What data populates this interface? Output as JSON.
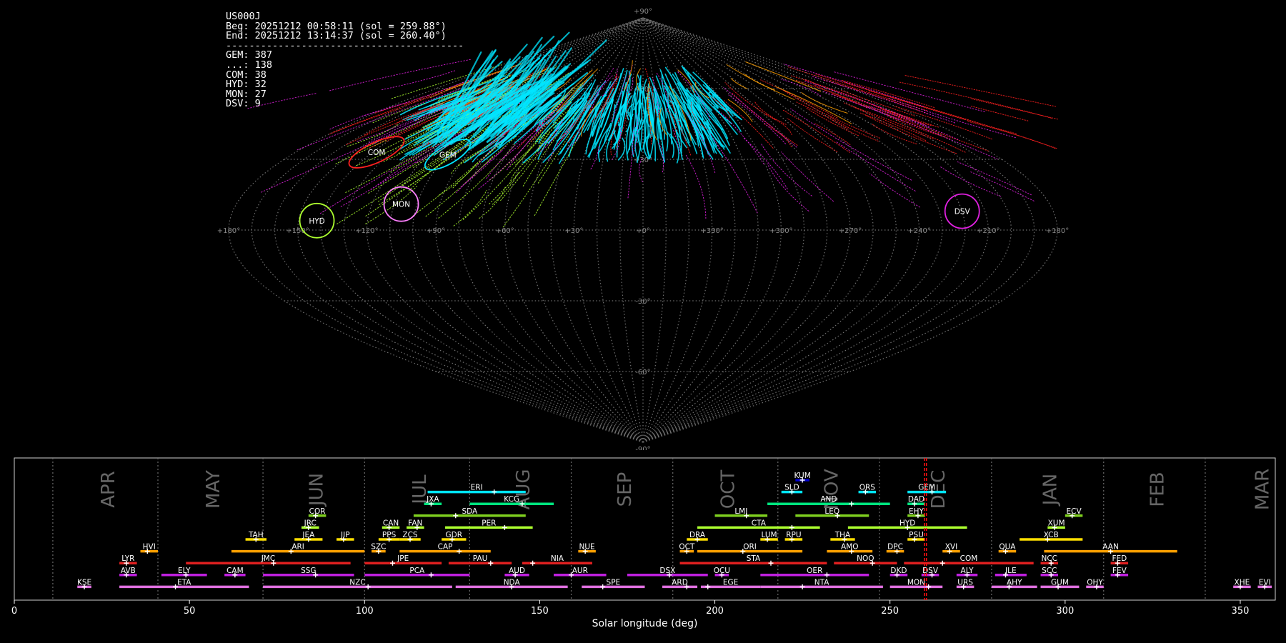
{
  "summary": {
    "station": "US000J",
    "begin": "Beg: 20251212 00:58:11 (sol = 259.88°)",
    "end": "End: 20251212 13:14:37 (sol = 260.40°)",
    "separator": "-----------------------------------------",
    "counts": [
      "GEM: 387",
      "...: 138",
      "COM: 38",
      "HYD: 32",
      "MON: 27",
      "DSV: 9"
    ]
  },
  "chart_data": [
    {
      "type": "scatter",
      "projection": "sinusoidal all-sky map (sun-centred ecliptic longitude / latitude)",
      "lon_tick_labels": [
        "+180°",
        "+150°",
        "+120°",
        "+90°",
        "+60°",
        "+30°",
        "+0°",
        "+330°",
        "+300°",
        "+270°",
        "+240°",
        "+210°",
        "+180°"
      ],
      "lat_tick_labels": [
        "+90°",
        "+60°",
        "+30°",
        "-30°",
        "-60°",
        "-90°"
      ],
      "grid": true,
      "showers": [
        {
          "name": "COM",
          "color": "#ff2020",
          "lon": 138,
          "lat": 33
        },
        {
          "name": "GEM",
          "color": "#00e5ff",
          "lon": 100,
          "lat": 32
        },
        {
          "name": "MON",
          "color": "#ff7fff",
          "lon": 107,
          "lat": 11
        },
        {
          "name": "HYD",
          "color": "#adff2f",
          "lon": 142,
          "lat": 4
        },
        {
          "name": "DSV",
          "color": "#e020e0",
          "lon": 220,
          "lat": 8
        }
      ]
    },
    {
      "type": "bar",
      "xlabel": "Solar longitude (deg)",
      "xlim": [
        0,
        360
      ],
      "x_ticks": [
        0,
        50,
        100,
        150,
        200,
        250,
        300,
        350
      ],
      "month_labels": [
        "APR",
        "MAY",
        "JUN",
        "JUL",
        "AUG",
        "SEP",
        "OCT",
        "NOV",
        "DEC",
        "JAN",
        "FEB",
        "MAR"
      ],
      "month_boundaries": [
        11,
        41,
        71,
        100,
        130,
        159,
        188,
        218,
        247,
        279,
        311,
        340
      ],
      "current_solar_longitude": [
        259.88,
        260.4
      ],
      "showers": [
        {
          "name": "KUM",
          "start": 223,
          "end": 227,
          "peak": 225,
          "row": 10,
          "color": "#0000cc"
        },
        {
          "name": "ERI",
          "start": 118,
          "end": 146,
          "peak": 137,
          "row": 9,
          "color": "#00e5ff"
        },
        {
          "name": "SLD",
          "start": 219,
          "end": 225,
          "peak": 222,
          "row": 9,
          "color": "#00e5ff"
        },
        {
          "name": "ORS",
          "start": 241,
          "end": 246,
          "peak": 243,
          "row": 9,
          "color": "#00e5ff"
        },
        {
          "name": "GEM",
          "start": 255,
          "end": 266,
          "peak": 262,
          "row": 9,
          "color": "#00e5ff"
        },
        {
          "name": "JXA",
          "start": 117,
          "end": 122,
          "peak": 119,
          "row": 8,
          "color": "#00e57f"
        },
        {
          "name": "KCG",
          "start": 130,
          "end": 154,
          "peak": 145,
          "row": 8,
          "color": "#00e57f"
        },
        {
          "name": "AND",
          "start": 215,
          "end": 250,
          "peak": 239,
          "row": 8,
          "color": "#00e57f"
        },
        {
          "name": "DAD",
          "start": 255,
          "end": 260,
          "peak": 257,
          "row": 8,
          "color": "#00e57f"
        },
        {
          "name": "COR",
          "start": 84,
          "end": 89,
          "peak": 86,
          "row": 7,
          "color": "#7fd01f"
        },
        {
          "name": "SDA",
          "start": 114,
          "end": 146,
          "peak": 126,
          "row": 7,
          "color": "#7fd01f"
        },
        {
          "name": "LMI",
          "start": 200,
          "end": 215,
          "peak": 209,
          "row": 7,
          "color": "#7fd01f"
        },
        {
          "name": "LEQ",
          "start": 223,
          "end": 244,
          "peak": 235,
          "row": 7,
          "color": "#7fd01f"
        },
        {
          "name": "EHY",
          "start": 255,
          "end": 260,
          "peak": 258,
          "row": 7,
          "color": "#7fd01f"
        },
        {
          "name": "ECV",
          "start": 300,
          "end": 305,
          "peak": 302,
          "row": 7,
          "color": "#7fd01f"
        },
        {
          "name": "JRC",
          "start": 82,
          "end": 87,
          "peak": 84,
          "row": 6,
          "color": "#adff2f"
        },
        {
          "name": "CAN",
          "start": 105,
          "end": 110,
          "peak": 107,
          "row": 6,
          "color": "#adff2f"
        },
        {
          "name": "FAN",
          "start": 112,
          "end": 117,
          "peak": 115,
          "row": 6,
          "color": "#adff2f"
        },
        {
          "name": "PER",
          "start": 123,
          "end": 148,
          "peak": 140,
          "row": 6,
          "color": "#adff2f"
        },
        {
          "name": "CTA",
          "start": 195,
          "end": 230,
          "peak": 222,
          "row": 6,
          "color": "#adff2f"
        },
        {
          "name": "HYD",
          "start": 238,
          "end": 272,
          "peak": 255,
          "row": 6,
          "color": "#adff2f"
        },
        {
          "name": "XUM",
          "start": 295,
          "end": 300,
          "peak": 297,
          "row": 6,
          "color": "#adff2f"
        },
        {
          "name": "TAH",
          "start": 66,
          "end": 72,
          "peak": 69,
          "row": 5,
          "color": "#ffe000"
        },
        {
          "name": "JEA",
          "start": 80,
          "end": 88,
          "peak": 84,
          "row": 5,
          "color": "#ffe000"
        },
        {
          "name": "JIP",
          "start": 92,
          "end": 97,
          "peak": 94,
          "row": 5,
          "color": "#ffe000"
        },
        {
          "name": "PPS",
          "start": 104,
          "end": 110,
          "peak": 107,
          "row": 5,
          "color": "#ffe000"
        },
        {
          "name": "ZCS",
          "start": 110,
          "end": 116,
          "peak": 113,
          "row": 5,
          "color": "#ffe000"
        },
        {
          "name": "GDR",
          "start": 122,
          "end": 129,
          "peak": 125,
          "row": 5,
          "color": "#ffe000"
        },
        {
          "name": "DRA",
          "start": 192,
          "end": 198,
          "peak": 195,
          "row": 5,
          "color": "#ffe000"
        },
        {
          "name": "LUM",
          "start": 213,
          "end": 218,
          "peak": 215,
          "row": 5,
          "color": "#ffe000"
        },
        {
          "name": "RPU",
          "start": 220,
          "end": 225,
          "peak": 222,
          "row": 5,
          "color": "#ffe000"
        },
        {
          "name": "THA",
          "start": 233,
          "end": 240,
          "peak": 237,
          "row": 5,
          "color": "#ffe000"
        },
        {
          "name": "PSU",
          "start": 255,
          "end": 260,
          "peak": 257,
          "row": 5,
          "color": "#ffe000"
        },
        {
          "name": "XCB",
          "start": 287,
          "end": 305,
          "peak": 295,
          "row": 5,
          "color": "#ffe000"
        },
        {
          "name": "HVI",
          "start": 36,
          "end": 41,
          "peak": 38,
          "row": 4,
          "color": "#ffa000"
        },
        {
          "name": "ARI",
          "start": 62,
          "end": 100,
          "peak": 79,
          "row": 4,
          "color": "#ffa000"
        },
        {
          "name": "SZC",
          "start": 102,
          "end": 106,
          "peak": 104,
          "row": 4,
          "color": "#ffa000"
        },
        {
          "name": "CAP",
          "start": 110,
          "end": 136,
          "peak": 127,
          "row": 4,
          "color": "#ffa000"
        },
        {
          "name": "NUE",
          "start": 161,
          "end": 166,
          "peak": 163,
          "row": 4,
          "color": "#ffa000"
        },
        {
          "name": "OCT",
          "start": 190,
          "end": 194,
          "peak": 192,
          "row": 4,
          "color": "#ffa000"
        },
        {
          "name": "ORI",
          "start": 195,
          "end": 225,
          "peak": 208,
          "row": 4,
          "color": "#ffa000"
        },
        {
          "name": "AMO",
          "start": 232,
          "end": 245,
          "peak": 239,
          "row": 4,
          "color": "#ffa000"
        },
        {
          "name": "DPC",
          "start": 249,
          "end": 254,
          "peak": 252,
          "row": 4,
          "color": "#ffa000"
        },
        {
          "name": "XVI",
          "start": 265,
          "end": 270,
          "peak": 267,
          "row": 4,
          "color": "#ffa000"
        },
        {
          "name": "QUA",
          "start": 281,
          "end": 286,
          "peak": 283,
          "row": 4,
          "color": "#ffa000"
        },
        {
          "name": "AAN",
          "start": 294,
          "end": 332,
          "peak": 313,
          "row": 4,
          "color": "#ffa000"
        },
        {
          "name": "LYR",
          "start": 30,
          "end": 35,
          "peak": 32,
          "row": 3,
          "color": "#e02020"
        },
        {
          "name": "JMC",
          "start": 49,
          "end": 96,
          "peak": 74,
          "row": 3,
          "color": "#e02020"
        },
        {
          "name": "JPE",
          "start": 100,
          "end": 122,
          "peak": 108,
          "row": 3,
          "color": "#e02020"
        },
        {
          "name": "PAU",
          "start": 124,
          "end": 142,
          "peak": 136,
          "row": 3,
          "color": "#e02020"
        },
        {
          "name": "NIA",
          "start": 145,
          "end": 165,
          "peak": 148,
          "row": 3,
          "color": "#e02020"
        },
        {
          "name": "STA",
          "start": 190,
          "end": 232,
          "peak": 216,
          "row": 3,
          "color": "#e02020"
        },
        {
          "name": "NOO",
          "start": 234,
          "end": 252,
          "peak": 245,
          "row": 3,
          "color": "#e02020"
        },
        {
          "name": "COM",
          "start": 254,
          "end": 291,
          "peak": 265,
          "row": 3,
          "color": "#e02020"
        },
        {
          "name": "NCC",
          "start": 293,
          "end": 298,
          "peak": 296,
          "row": 3,
          "color": "#e02020"
        },
        {
          "name": "FED",
          "start": 313,
          "end": 318,
          "peak": 315,
          "row": 3,
          "color": "#e02020"
        },
        {
          "name": "AVB",
          "start": 30,
          "end": 35,
          "peak": 32,
          "row": 2,
          "color": "#c020e0"
        },
        {
          "name": "ELY",
          "start": 42,
          "end": 55,
          "peak": 49,
          "row": 2,
          "color": "#c020e0"
        },
        {
          "name": "CAM",
          "start": 60,
          "end": 66,
          "peak": 63,
          "row": 2,
          "color": "#c020e0"
        },
        {
          "name": "SSG",
          "start": 71,
          "end": 97,
          "peak": 86,
          "row": 2,
          "color": "#c020e0"
        },
        {
          "name": "PCA",
          "start": 100,
          "end": 130,
          "peak": 119,
          "row": 2,
          "color": "#c020e0"
        },
        {
          "name": "AUD",
          "start": 140,
          "end": 147,
          "peak": 143,
          "row": 2,
          "color": "#c020e0"
        },
        {
          "name": "AUR",
          "start": 154,
          "end": 169,
          "peak": 159,
          "row": 2,
          "color": "#c020e0"
        },
        {
          "name": "DSX",
          "start": 175,
          "end": 198,
          "peak": 187,
          "row": 2,
          "color": "#c020e0"
        },
        {
          "name": "OCU",
          "start": 200,
          "end": 204,
          "peak": 202,
          "row": 2,
          "color": "#c020e0"
        },
        {
          "name": "OER",
          "start": 213,
          "end": 244,
          "peak": 232,
          "row": 2,
          "color": "#c020e0"
        },
        {
          "name": "DKD",
          "start": 250,
          "end": 255,
          "peak": 252,
          "row": 2,
          "color": "#c020e0"
        },
        {
          "name": "DSV",
          "start": 259,
          "end": 264,
          "peak": 262,
          "row": 2,
          "color": "#c020e0"
        },
        {
          "name": "ALY",
          "start": 269,
          "end": 275,
          "peak": 272,
          "row": 2,
          "color": "#c020e0"
        },
        {
          "name": "JLE",
          "start": 280,
          "end": 289,
          "peak": 283,
          "row": 2,
          "color": "#c020e0"
        },
        {
          "name": "SCC",
          "start": 293,
          "end": 298,
          "peak": 296,
          "row": 2,
          "color": "#c020e0"
        },
        {
          "name": "FEV",
          "start": 313,
          "end": 318,
          "peak": 315,
          "row": 2,
          "color": "#c020e0"
        },
        {
          "name": "KSE",
          "start": 18,
          "end": 22,
          "peak": 20,
          "row": 1,
          "color": "#e070e0"
        },
        {
          "name": "ETA",
          "start": 30,
          "end": 67,
          "peak": 46,
          "row": 1,
          "color": "#e070e0"
        },
        {
          "name": "NZC",
          "start": 71,
          "end": 125,
          "peak": 101,
          "row": 1,
          "color": "#e070e0"
        },
        {
          "name": "NDA",
          "start": 126,
          "end": 158,
          "peak": 142,
          "row": 1,
          "color": "#e070e0"
        },
        {
          "name": "SPE",
          "start": 162,
          "end": 180,
          "peak": 168,
          "row": 1,
          "color": "#e070e0"
        },
        {
          "name": "ARD",
          "start": 185,
          "end": 195,
          "peak": 192,
          "row": 1,
          "color": "#e070e0"
        },
        {
          "name": "EGE",
          "start": 196,
          "end": 213,
          "peak": 198,
          "row": 1,
          "color": "#e070e0"
        },
        {
          "name": "NTA",
          "start": 213,
          "end": 248,
          "peak": 225,
          "row": 1,
          "color": "#e070e0"
        },
        {
          "name": "MON",
          "start": 250,
          "end": 265,
          "peak": 261,
          "row": 1,
          "color": "#e070e0"
        },
        {
          "name": "URS",
          "start": 269,
          "end": 274,
          "peak": 271,
          "row": 1,
          "color": "#e070e0"
        },
        {
          "name": "AHY",
          "start": 279,
          "end": 292,
          "peak": 284,
          "row": 1,
          "color": "#e070e0"
        },
        {
          "name": "GUM",
          "start": 293,
          "end": 304,
          "peak": 298,
          "row": 1,
          "color": "#e070e0"
        },
        {
          "name": "OHY",
          "start": 306,
          "end": 311,
          "peak": 309,
          "row": 1,
          "color": "#e070e0"
        },
        {
          "name": "XHE",
          "start": 348,
          "end": 353,
          "peak": 350,
          "row": 1,
          "color": "#e070e0"
        },
        {
          "name": "EVI",
          "start": 355,
          "end": 359,
          "peak": 357,
          "row": 1,
          "color": "#e070e0"
        }
      ]
    }
  ]
}
